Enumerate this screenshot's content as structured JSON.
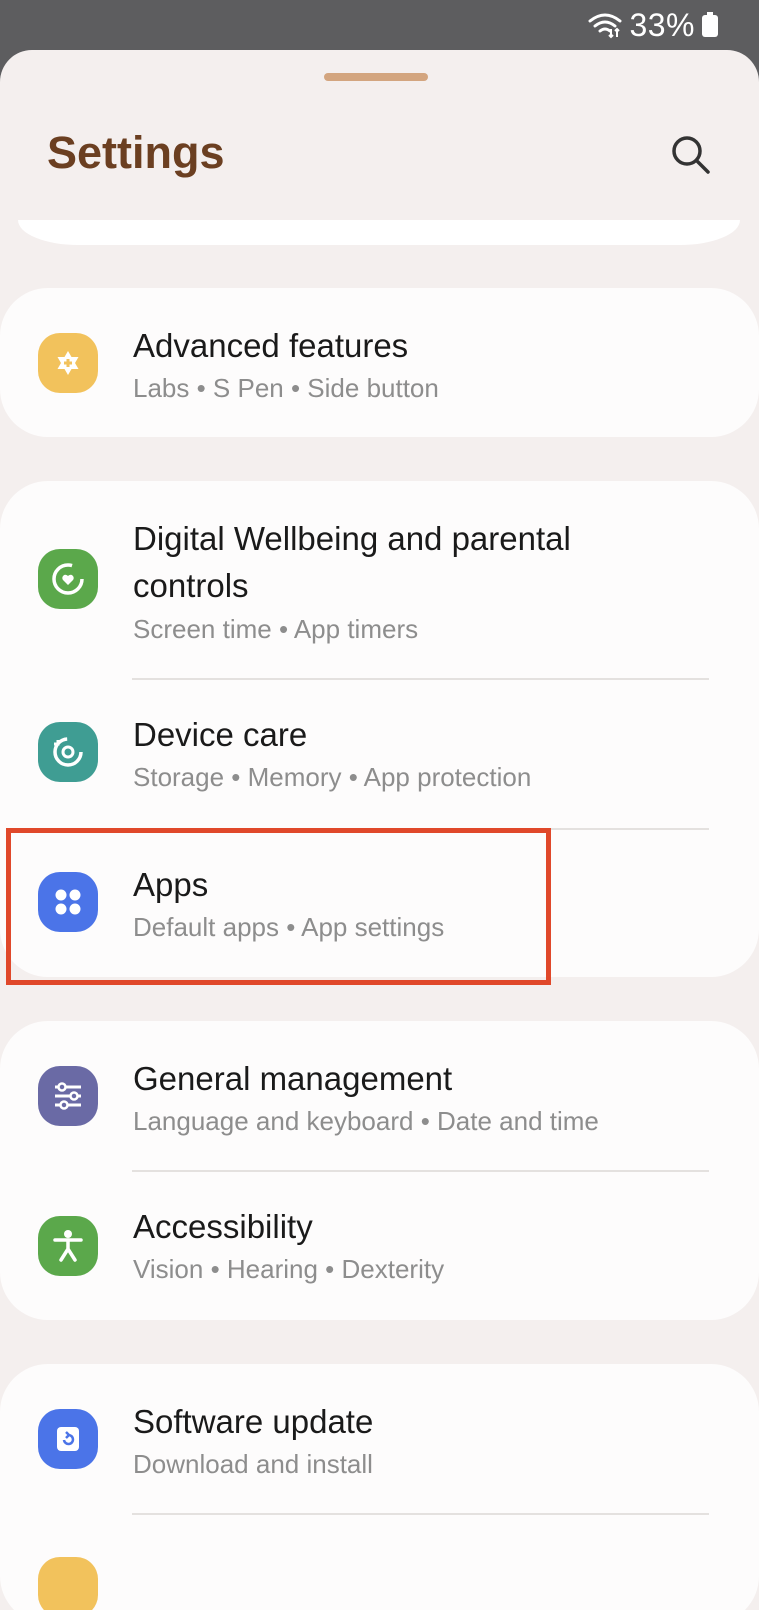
{
  "status_bar": {
    "battery_text": "33%",
    "wifi_icon": "wifi-icon",
    "battery_icon": "battery-icon"
  },
  "header": {
    "title": "Settings",
    "search_icon": "search-icon"
  },
  "colors": {
    "title": "#6b3f21",
    "handle": "#d3a57f",
    "highlight": "#e0482a"
  },
  "groups": [
    {
      "items": [
        {
          "title": "Advanced features",
          "subtitle": "Labs  •  S Pen  •  Side button",
          "icon": "advanced-features-icon",
          "icon_color": "#f2c25c"
        }
      ]
    },
    {
      "items": [
        {
          "title": "Digital Wellbeing and parental controls",
          "subtitle": "Screen time  •  App timers",
          "icon": "digital-wellbeing-icon",
          "icon_color": "#5ba84b"
        },
        {
          "title": "Device care",
          "subtitle": "Storage  •  Memory  •  App protection",
          "icon": "device-care-icon",
          "icon_color": "#3f9d93"
        },
        {
          "title": "Apps",
          "subtitle": "Default apps  •  App settings",
          "icon": "apps-icon",
          "icon_color": "#4b74e8",
          "highlighted": true
        }
      ]
    },
    {
      "items": [
        {
          "title": "General management",
          "subtitle": "Language and keyboard  •  Date and time",
          "icon": "general-management-icon",
          "icon_color": "#6a6aa5"
        },
        {
          "title": "Accessibility",
          "subtitle": "Vision  •  Hearing  •  Dexterity",
          "icon": "accessibility-icon",
          "icon_color": "#5ba84b"
        }
      ]
    },
    {
      "items": [
        {
          "title": "Software update",
          "subtitle": "Download and install",
          "icon": "software-update-icon",
          "icon_color": "#4b74e8"
        }
      ]
    }
  ]
}
